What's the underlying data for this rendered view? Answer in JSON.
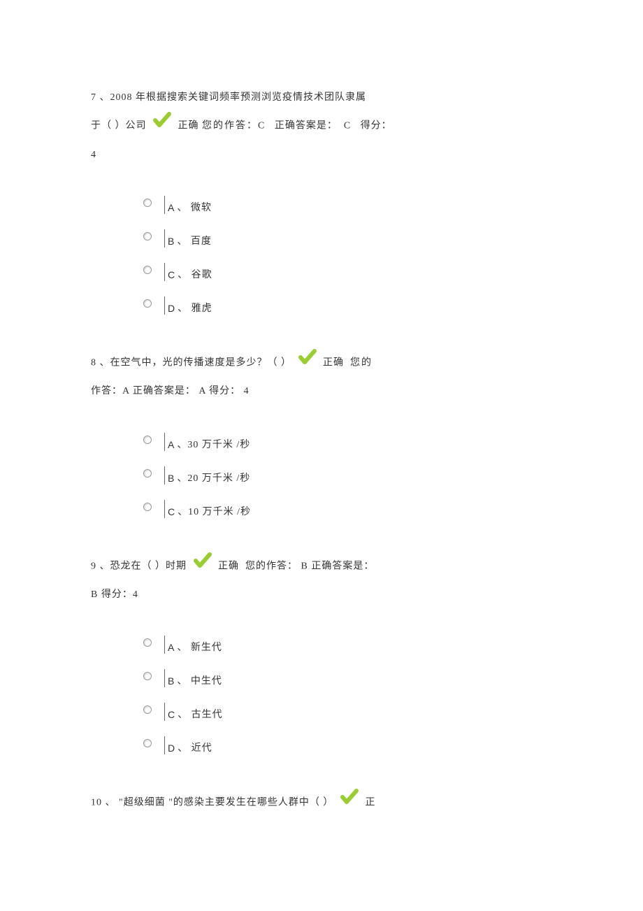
{
  "questions": [
    {
      "number": "7 、2008",
      "text_pre": "   年根据搜索关键词频率预测浏览疫情技术团队隶属",
      "text_line2_pre": "于（   ）公司",
      "result_label": "正确",
      "your_answer_label": "您的作答：",
      "your_answer": "C",
      "correct_label": "正确答案是：",
      "correct_answer": "C",
      "score_label": "得分：",
      "score_line2": "4",
      "options": [
        {
          "letter": "A",
          "text": "、 微软"
        },
        {
          "letter": "B",
          "text": "、 百度"
        },
        {
          "letter": "C",
          "text": "、 谷歌"
        },
        {
          "letter": "D",
          "text": "、 雅虎"
        }
      ]
    },
    {
      "number": "8",
      "text_pre": " 、在空气中，光的传播速度是多少？（         ）",
      "result_label": "正确",
      "your_label": "您的",
      "line2": "作答：A   正确答案是：  A   得分：  4",
      "options": [
        {
          "letter": "A",
          "text": " 、30  万千米  /秒"
        },
        {
          "letter": "B",
          "text": " 、20  万千米  /秒"
        },
        {
          "letter": "C",
          "text": " 、10  万千米  /秒"
        }
      ]
    },
    {
      "number": "9",
      "text_pre": " 、恐龙在（     ）时期",
      "result_label": "正确",
      "after": "您的作答：  B    正确答案是：",
      "line2": "B   得分：4",
      "options": [
        {
          "letter": "A",
          "text": " 、 新生代"
        },
        {
          "letter": "B",
          "text": " 、 中生代"
        },
        {
          "letter": "C",
          "text": " 、 古生代"
        },
        {
          "letter": "D",
          "text": " 、 近代"
        }
      ]
    },
    {
      "number": "10",
      "text_pre": "  、  \"超级细菌    \"的感染主要发生在哪些人群中（         ）",
      "result_label": "正",
      "options": []
    }
  ],
  "checkmark_color": "#9ACD32"
}
